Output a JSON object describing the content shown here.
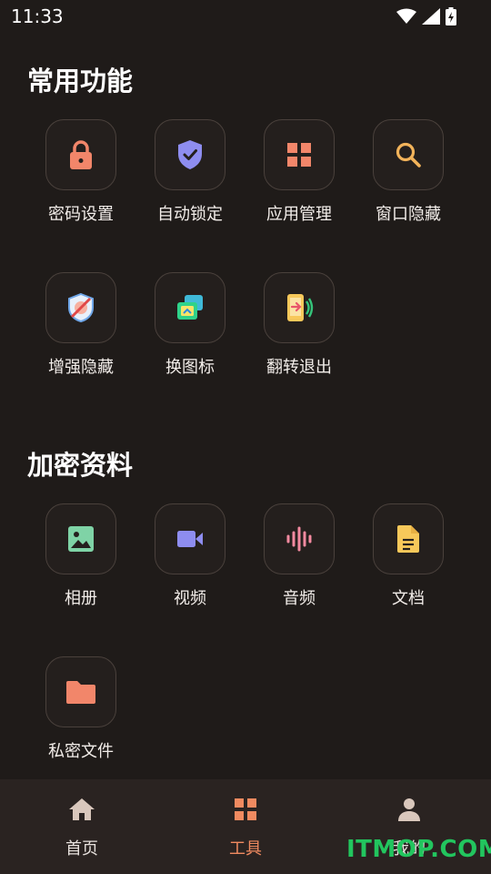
{
  "status_bar": {
    "time": "11:33"
  },
  "sections": [
    {
      "title": "常用功能",
      "items": [
        {
          "label": "密码设置",
          "icon": "lock-icon"
        },
        {
          "label": "自动锁定",
          "icon": "shield-check-icon"
        },
        {
          "label": "应用管理",
          "icon": "grid-icon"
        },
        {
          "label": "窗口隐藏",
          "icon": "search-icon"
        },
        {
          "label": "增强隐藏",
          "icon": "enhanced-hide-icon"
        },
        {
          "label": "换图标",
          "icon": "change-icon-icon"
        },
        {
          "label": "翻转退出",
          "icon": "flip-exit-icon"
        }
      ]
    },
    {
      "title": "加密资料",
      "items": [
        {
          "label": "相册",
          "icon": "image-icon"
        },
        {
          "label": "视频",
          "icon": "video-icon"
        },
        {
          "label": "音频",
          "icon": "audio-icon"
        },
        {
          "label": "文档",
          "icon": "document-icon"
        },
        {
          "label": "私密文件",
          "icon": "folder-icon"
        }
      ]
    }
  ],
  "bottom_nav": [
    {
      "label": "首页",
      "icon": "home-icon",
      "active": false
    },
    {
      "label": "工具",
      "icon": "tools-grid-icon",
      "active": true
    },
    {
      "label": "我的",
      "icon": "profile-icon",
      "active": false
    }
  ],
  "watermark": "ITMOP.COM",
  "colors": {
    "background": "#1f1b19",
    "accent": "#f08a60",
    "tile_border": "#4a413c",
    "watermark": "#22c55e"
  }
}
